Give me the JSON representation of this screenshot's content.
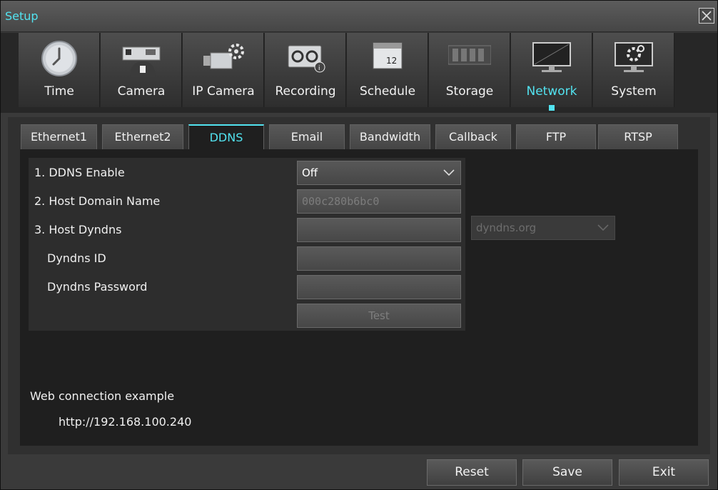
{
  "window": {
    "title": "Setup"
  },
  "nav": [
    {
      "id": "time",
      "label": "Time",
      "icon": "clock-icon",
      "active": false
    },
    {
      "id": "camera",
      "label": "Camera",
      "icon": "dome-camera-icon",
      "active": false
    },
    {
      "id": "ipcamera",
      "label": "IP Camera",
      "icon": "ip-camera-icon",
      "active": false
    },
    {
      "id": "recording",
      "label": "Recording",
      "icon": "recording-tape-icon",
      "active": false
    },
    {
      "id": "schedule",
      "label": "Schedule",
      "icon": "calendar-icon",
      "active": false
    },
    {
      "id": "storage",
      "label": "Storage",
      "icon": "hard-disk-icon",
      "active": false
    },
    {
      "id": "network",
      "label": "Network",
      "icon": "monitor-icon",
      "active": true
    },
    {
      "id": "system",
      "label": "System",
      "icon": "system-gear-monitor-icon",
      "active": false
    }
  ],
  "calendar_icon_number": "12",
  "tabs": [
    {
      "label": "Ethernet1",
      "active": false
    },
    {
      "label": "Ethernet2",
      "active": false
    },
    {
      "label": "DDNS",
      "active": true
    },
    {
      "label": "Email",
      "active": false
    },
    {
      "label": "Bandwidth",
      "active": false
    },
    {
      "label": "Callback",
      "active": false
    },
    {
      "label": "FTP",
      "active": false
    },
    {
      "label": "RTSP",
      "active": false
    }
  ],
  "form": {
    "ddns_enable": {
      "label": "1. DDNS Enable",
      "value": "Off"
    },
    "host_domain_name": {
      "label": "2. Host Domain Name",
      "value": "000c280b6bc0"
    },
    "host_dyndns": {
      "label": "3. Host Dyndns",
      "value": "",
      "provider": "dyndns.org"
    },
    "dyndns_id": {
      "label": "Dyndns ID",
      "value": ""
    },
    "dyndns_password": {
      "label": "Dyndns Password",
      "value": ""
    },
    "test_label": "Test"
  },
  "hint": {
    "title": "Web connection example",
    "url": "http://192.168.100.240"
  },
  "buttons": {
    "reset": "Reset",
    "save": "Save",
    "exit": "Exit"
  },
  "colors": {
    "accent": "#52e3f0",
    "background": "#1f1f1f"
  }
}
